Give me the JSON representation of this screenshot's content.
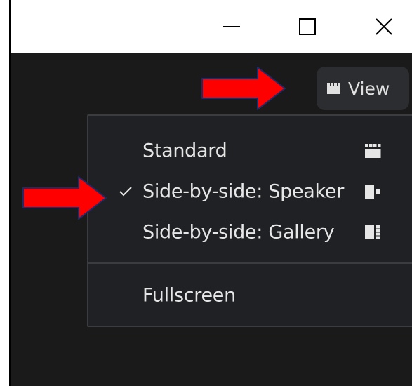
{
  "window_controls": {
    "minimize_icon": "minimize-icon",
    "maximize_icon": "maximize-icon",
    "close_icon": "close-icon"
  },
  "toolbar": {
    "view_button_label": "View",
    "view_icon": "standard-view-icon"
  },
  "view_menu": {
    "items": [
      {
        "label": "Standard",
        "checked": false,
        "icon": "standard-view-icon"
      },
      {
        "label": "Side-by-side: Speaker",
        "checked": true,
        "icon": "speaker-view-icon"
      },
      {
        "label": "Side-by-side: Gallery",
        "checked": false,
        "icon": "gallery-view-icon"
      }
    ],
    "fullscreen_label": "Fullscreen"
  },
  "annotations": {
    "arrow_color": "#ff0000",
    "arrow_outline": "#1f2a6b"
  },
  "colors": {
    "background": "#1a1a1a",
    "menu_background": "#202124",
    "menu_border": "#3b3c3f",
    "text": "#e6e6e6",
    "titlebar": "#ffffff"
  }
}
